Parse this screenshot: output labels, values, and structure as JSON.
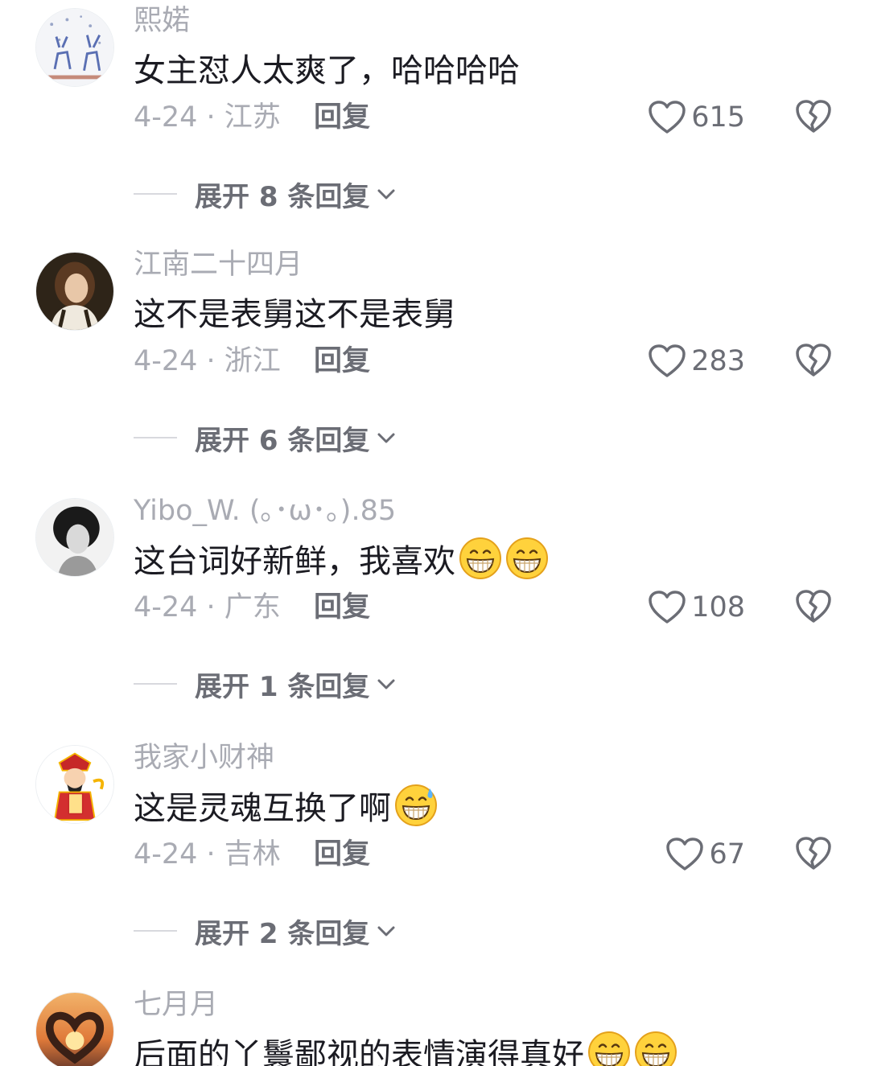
{
  "comments": [
    {
      "username": "熙婼",
      "text": "女主怼人太爽了，哈哈哈哈",
      "meta": "4-24 · 江苏",
      "reply_label": "回复",
      "likes": "615",
      "expand_label": "展开 8 条回复",
      "avatar_icon": "deer-avatar"
    },
    {
      "username": "江南二十四月",
      "text": "这不是表舅这不是表舅",
      "meta": "4-24 · 浙江",
      "reply_label": "回复",
      "likes": "283",
      "expand_label": "展开 6 条回复",
      "avatar_icon": "portrait-avatar"
    },
    {
      "username": "Yibo_W. (｡･ω･｡).85",
      "text": "这台词好新鲜，我喜欢",
      "emojis": [
        "grin-emoji",
        "grin-emoji"
      ],
      "meta": "4-24 · 广东",
      "reply_label": "回复",
      "likes": "108",
      "expand_label": "展开 1 条回复",
      "avatar_icon": "bw-portrait-avatar"
    },
    {
      "username": "我家小财神",
      "text": "这是灵魂互换了啊",
      "emojis": [
        "sweat-grin-emoji"
      ],
      "meta": "4-24 · 吉林",
      "reply_label": "回复",
      "likes": "67",
      "expand_label": "展开 2 条回复",
      "avatar_icon": "caishen-avatar"
    },
    {
      "username": "七月月",
      "text": "后面的丫鬟鄙视的表情演得真好",
      "emojis": [
        "grin-emoji",
        "grin-emoji"
      ],
      "avatar_icon": "heart-hands-avatar"
    }
  ]
}
